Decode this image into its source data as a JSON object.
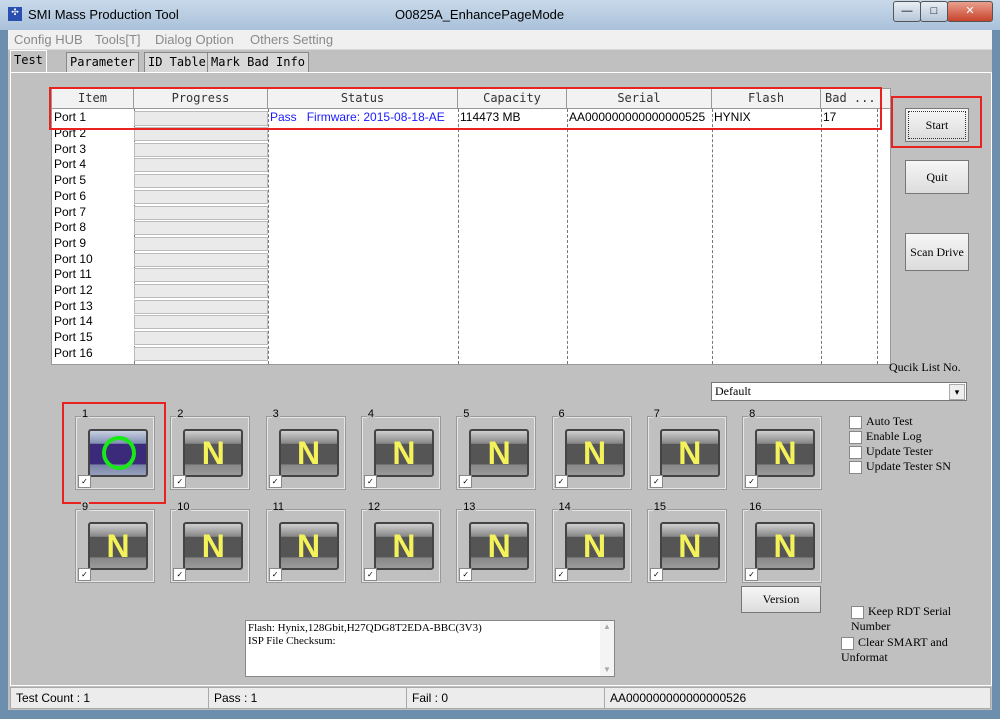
{
  "window": {
    "title": "SMI Mass Production Tool",
    "subtitle": "O0825A_EnhancePageMode",
    "minimize": "—",
    "maximize": "□",
    "close": "✕"
  },
  "menu": [
    "Config HUB",
    "Tools[T]",
    "Dialog Option",
    "Others Setting"
  ],
  "tabs": [
    "Test",
    "Parameter",
    "ID Table",
    "Mark Bad Info"
  ],
  "table": {
    "headers": [
      "Item",
      "Progress",
      "Status",
      "Capacity",
      "Serial",
      "Flash",
      "Bad ..."
    ],
    "row1": {
      "item": "Port 1",
      "status_result": "Pass",
      "status_detail": "Firmware: 2015-08-18-AE",
      "capacity": "114473 MB",
      "serial": "AA000000000000000525",
      "flash": "HYNIX",
      "bad": "17"
    },
    "ports": [
      "Port 2",
      "Port 3",
      "Port 4",
      "Port 5",
      "Port 6",
      "Port 7",
      "Port 8",
      "Port 9",
      "Port 10",
      "Port 11",
      "Port 12",
      "Port 13",
      "Port 14",
      "Port 15",
      "Port 16"
    ],
    "status_color": "#1a1aff"
  },
  "buttons": {
    "start": "Start",
    "quit": "Quit",
    "scan": "Scan Drive",
    "version": "Version"
  },
  "quick_list": {
    "label": "Qucik List No.",
    "value": "Default"
  },
  "options": [
    {
      "label": "Auto Test",
      "checked": false
    },
    {
      "label": "Enable Log",
      "checked": false
    },
    {
      "label": "Update Tester",
      "checked": false
    },
    {
      "label": "Update Tester SN",
      "checked": false
    }
  ],
  "keep_rdt": {
    "label": "Keep RDT Serial Number",
    "checked": false
  },
  "clear_smart": {
    "label": "Clear SMART and Unformat",
    "checked": false
  },
  "port_tiles": [
    {
      "num": "1",
      "state": "O"
    },
    {
      "num": "2",
      "state": "N"
    },
    {
      "num": "3",
      "state": "N"
    },
    {
      "num": "4",
      "state": "N"
    },
    {
      "num": "5",
      "state": "N"
    },
    {
      "num": "6",
      "state": "N"
    },
    {
      "num": "7",
      "state": "N"
    },
    {
      "num": "8",
      "state": "N"
    },
    {
      "num": "9",
      "state": "N"
    },
    {
      "num": "10",
      "state": "N"
    },
    {
      "num": "11",
      "state": "N"
    },
    {
      "num": "12",
      "state": "N"
    },
    {
      "num": "13",
      "state": "N"
    },
    {
      "num": "14",
      "state": "N"
    },
    {
      "num": "15",
      "state": "N"
    },
    {
      "num": "16",
      "state": "N"
    }
  ],
  "log": [
    "Flash: Hynix,128Gbit,H27QDG8T2EDA-BBC(3V3)",
    "ISP File Checksum:"
  ],
  "statusbar": {
    "count": "Test Count : 1",
    "pass": "Pass : 1",
    "fail": "Fail : 0",
    "serial": "AA000000000000000526"
  }
}
